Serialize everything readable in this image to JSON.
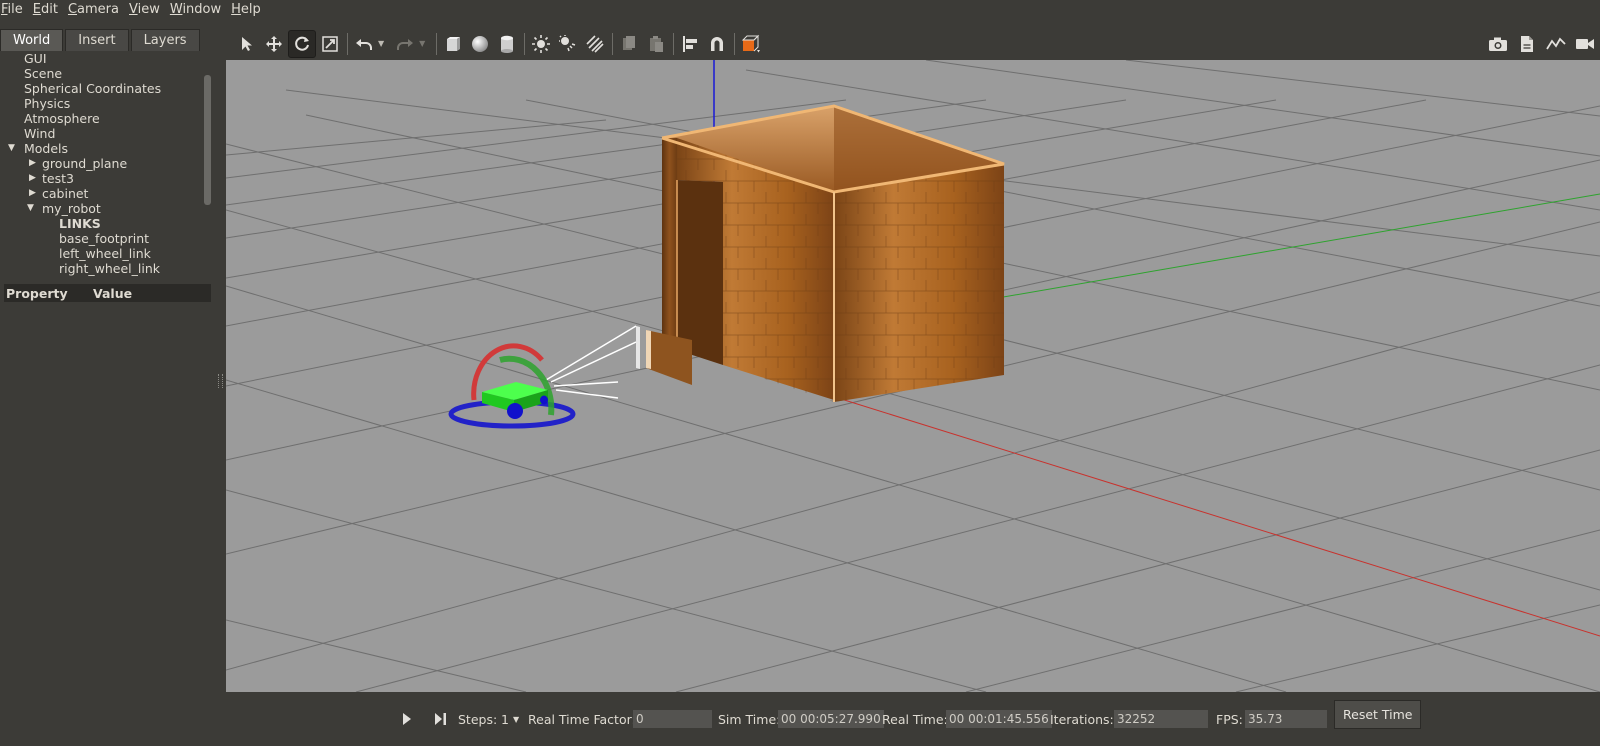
{
  "menubar": {
    "items": [
      {
        "mnemonic": "F",
        "rest": "ile"
      },
      {
        "mnemonic": "E",
        "rest": "dit"
      },
      {
        "mnemonic": "C",
        "rest": "amera"
      },
      {
        "mnemonic": "V",
        "rest": "iew"
      },
      {
        "mnemonic": "W",
        "rest": "indow"
      },
      {
        "mnemonic": "H",
        "rest": "elp"
      }
    ]
  },
  "left_panel": {
    "tabs": [
      {
        "label": "World",
        "active": true
      },
      {
        "label": "Insert",
        "active": false
      },
      {
        "label": "Layers",
        "active": false
      }
    ],
    "tree": {
      "gui": "GUI",
      "scene": "Scene",
      "spherical": "Spherical Coordinates",
      "physics": "Physics",
      "atmosphere": "Atmosphere",
      "wind": "Wind",
      "models": "Models",
      "ground_plane": "ground_plane",
      "test3": "test3",
      "cabinet": "cabinet",
      "my_robot": "my_robot",
      "links": "LINKS",
      "base_footprint": "base_footprint",
      "left_wheel_link": "left_wheel_link",
      "right_wheel_link": "right_wheel_link"
    },
    "property_header": {
      "property": "Property",
      "value": "Value"
    }
  },
  "toolbar": {
    "icons": [
      "select-arrow-icon",
      "translate-icon",
      "rotate-icon",
      "scale-icon",
      "undo-icon",
      "redo-icon",
      "box-icon",
      "sphere-icon",
      "cylinder-icon",
      "point-light-icon",
      "spot-light-icon",
      "directional-light-icon",
      "copy-icon",
      "paste-icon",
      "align-icon",
      "snap-magnet-icon",
      "view-angle-icon"
    ],
    "right_icons": [
      "screenshot-camera-icon",
      "log-icon",
      "plot-icon",
      "video-record-icon"
    ]
  },
  "bottom_bar": {
    "steps_label": "Steps:",
    "steps_value": "1",
    "rtf_label": "Real Time Factor:",
    "rtf_value": "0",
    "sim_time_label": "Sim Time:",
    "sim_time_value": "00 00:05:27.990",
    "real_time_label": "Real Time:",
    "real_time_value": "00 00:01:45.556",
    "iterations_label": "Iterations:",
    "iterations_value": "32252",
    "fps_label": "FPS:",
    "fps_value": "35.73",
    "reset_label": "Reset Time"
  },
  "colors": {
    "axis_x": "#c8322d",
    "axis_y": "#2ea32e",
    "axis_z": "#1b1bd6",
    "robot_body": "#22e322",
    "robot_wheel": "#1111cc",
    "wood": "#b8702a"
  }
}
